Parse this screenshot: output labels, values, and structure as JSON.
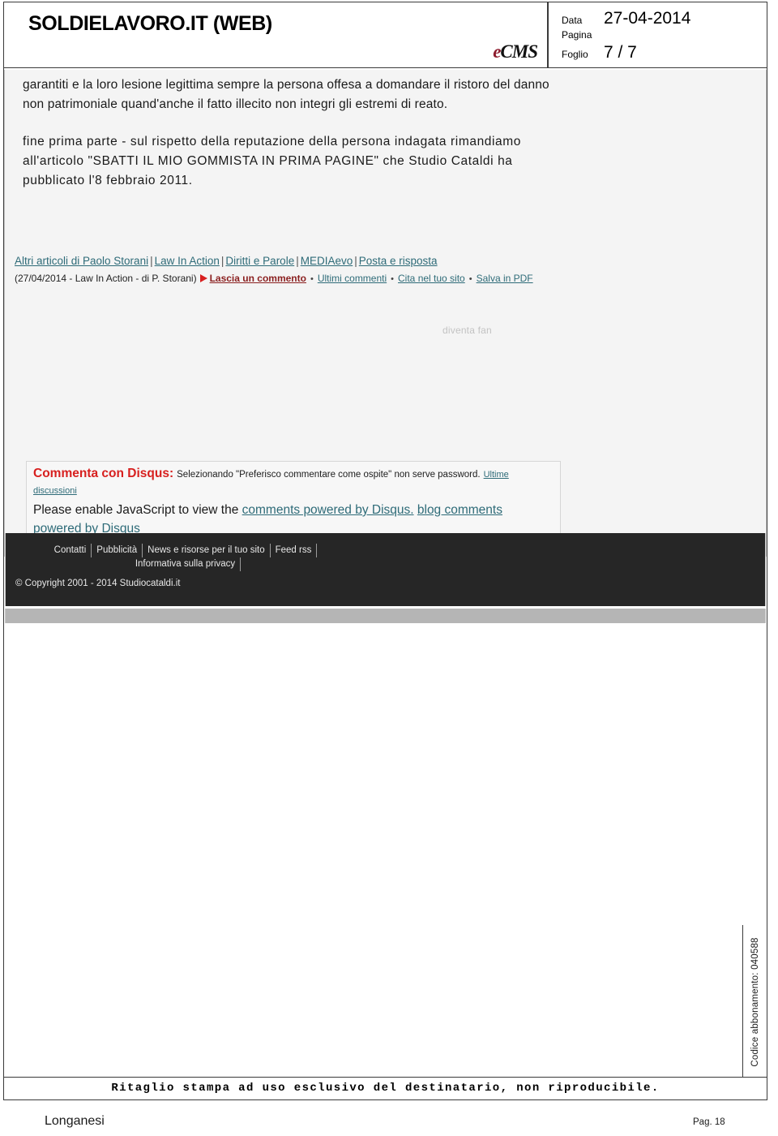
{
  "masthead": {
    "source": "SOLDIELAVORO.IT (WEB)",
    "logo_accent": "e",
    "logo_rest": "CMS",
    "meta": {
      "data_label": "Data",
      "data_value": "27-04-2014",
      "pagina_label": "Pagina",
      "pagina_value": "",
      "foglio_label": "Foglio",
      "foglio_value": "7 / 7"
    }
  },
  "article": {
    "paragraph_1": "garantiti e la loro lesione legittima sempre la persona offesa a domandare il ristoro del danno non patrimoniale quand'anche il fatto illecito non integri gli estremi di reato.",
    "paragraph_2": "fine prima parte - sul rispetto della reputazione della persona indagata rimandiamo all'articolo \"SBATTI IL MIO GOMMISTA IN PRIMA PAGINE\" che Studio Cataldi ha pubblicato l'8 febbraio 2011."
  },
  "article_links": {
    "items": [
      "Altri articoli di Paolo Storani",
      "Law In Action",
      "Diritti e Parole",
      "MEDIAevo",
      "Posta e risposta"
    ],
    "separator": "|"
  },
  "byline": {
    "credit": "(27/04/2014 - Law In Action - di P. Storani)",
    "comment_link": "Lascia un commento",
    "actions": [
      "Ultimi commenti",
      "Cita nel tuo sito",
      "Salva in PDF"
    ],
    "bullet": "•"
  },
  "fan_widget": {
    "label": "diventa fan"
  },
  "disqus": {
    "title": "Commenta con Disqus:",
    "note": "Selezionando \"Preferisco commentare come ospite\" non serve password.",
    "note_link": "Ultime discussioni",
    "body_prefix": "Please enable JavaScript to view the",
    "body_link_1": "comments powered by Disqus.",
    "body_link_2": "blog comments powered by Disqus"
  },
  "site_footer": {
    "nav": [
      "Contatti",
      "Pubblicità",
      "News e risorse per il tuo sito",
      "Feed rss",
      "Informativa sulla privacy"
    ],
    "copyright": "© Copyright 2001 - 2014 Studiocataldi.it"
  },
  "clipping_notice": "Ritaglio stampa ad uso esclusivo del destinatario, non riproducibile.",
  "subscription_code": "Codice abbonamento:   040588",
  "doc_footer": {
    "publisher": "Longanesi",
    "page": "Pag. 18"
  },
  "colors": {
    "disqus_red": "#d7201f",
    "link_teal": "#2e6b78",
    "comment_red": "#8a1f1f",
    "footer_dark": "#262626",
    "logo_red": "#8d1b2d"
  }
}
